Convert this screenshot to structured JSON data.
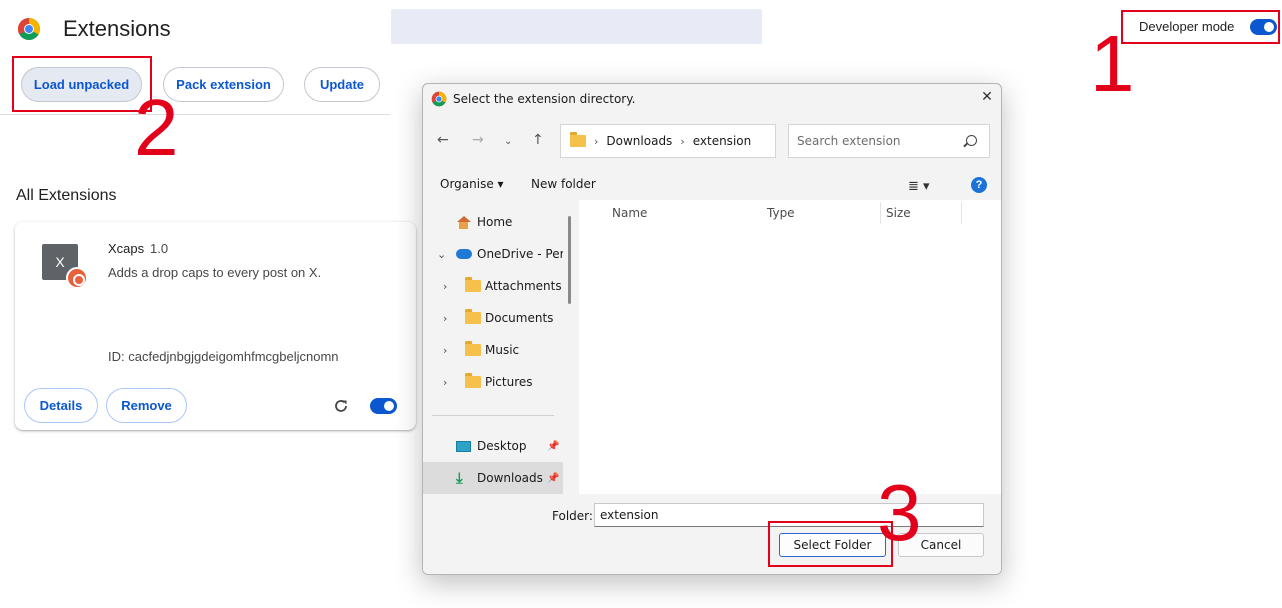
{
  "page": {
    "title": "Extensions",
    "developer_mode_label": "Developer mode",
    "developer_mode_on": true
  },
  "toolbar": {
    "load_unpacked": "Load unpacked",
    "pack_extension": "Pack extension",
    "update": "Update"
  },
  "extensions": {
    "heading": "All Extensions",
    "items": [
      {
        "icon_letter": "X",
        "name": "Xcaps",
        "version": "1.0",
        "description": "Adds a drop caps to every post on X.",
        "id_text": "ID: cacfedjnbgjgdeigomhfmcgbeljcnomn",
        "details": "Details",
        "remove": "Remove",
        "enabled": true
      }
    ]
  },
  "annotations": {
    "step1": "1",
    "step2": "2",
    "step3": "3",
    "color": "#e3001b"
  },
  "dialog": {
    "title": "Select the extension directory.",
    "close": "✕",
    "nav": {
      "back": "←",
      "forward": "→",
      "recent": "⌄",
      "up": "↑"
    },
    "breadcrumb": [
      "Downloads",
      "extension"
    ],
    "search_placeholder": "Search extension",
    "commands": {
      "organise": "Organise ▾",
      "new_folder": "New folder",
      "view": "≣ ▾",
      "help": "?"
    },
    "nav_items": [
      {
        "label": "Home",
        "icon": "home-icon"
      },
      {
        "label": "OneDrive - Perso",
        "icon": "cloud-icon"
      },
      {
        "label": "Attachments",
        "icon": "folder-icon"
      },
      {
        "label": "Documents",
        "icon": "folder-icon"
      },
      {
        "label": "Music",
        "icon": "folder-icon"
      },
      {
        "label": "Pictures",
        "icon": "folder-icon"
      },
      {
        "label": "Desktop",
        "icon": "desktop-icon"
      },
      {
        "label": "Downloads",
        "icon": "download-icon"
      }
    ],
    "columns": [
      "Name",
      "Type",
      "Size"
    ],
    "folder_label": "Folder:",
    "folder_value": "extension",
    "select_folder": "Select Folder",
    "cancel": "Cancel"
  }
}
